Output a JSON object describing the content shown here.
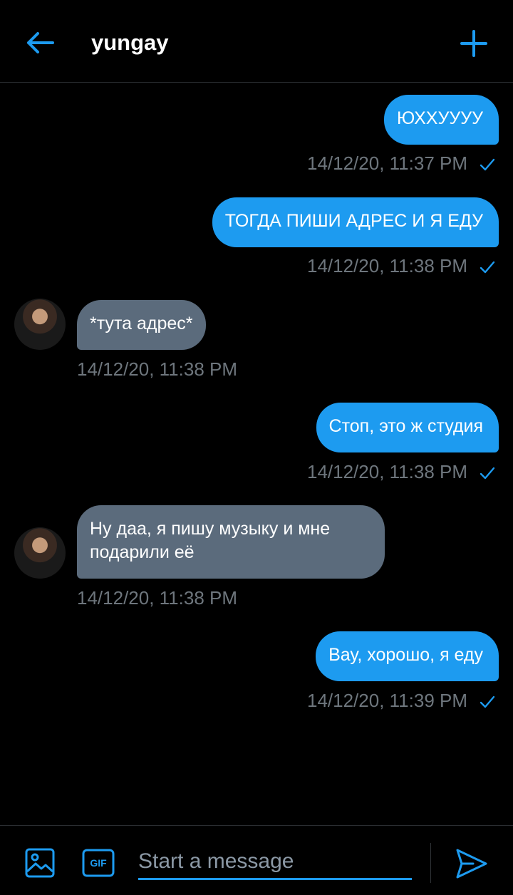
{
  "header": {
    "title": "yungay",
    "back_icon": "arrow-left-icon",
    "add_icon": "plus-icon",
    "accent": "#1d9bf0"
  },
  "messages": [
    {
      "direction": "out",
      "text": "ЮХХУУУУ",
      "timestamp": "14/12/20, 11:37 PM",
      "status": "sent-check-icon"
    },
    {
      "direction": "out",
      "text": "ТОГДА ПИШИ АДРЕС И Я ЕДУ",
      "timestamp": "14/12/20, 11:38 PM",
      "status": "sent-check-icon"
    },
    {
      "direction": "in",
      "text": "*тута адрес*",
      "timestamp": "14/12/20, 11:38 PM"
    },
    {
      "direction": "out",
      "text": "Стоп, это ж студия",
      "timestamp": "14/12/20, 11:38 PM",
      "status": "sent-check-icon"
    },
    {
      "direction": "in",
      "text": "Ну даа, я пишу музыку и мне\nподарили её",
      "timestamp": "14/12/20, 11:38 PM"
    },
    {
      "direction": "out",
      "text": "Вау, хорошо, я еду",
      "timestamp": "14/12/20, 11:39 PM",
      "status": "sent-check-icon"
    }
  ],
  "composer": {
    "placeholder": "Start a message",
    "image_icon": "image-icon",
    "gif_label": "GIF",
    "send_icon": "send-icon"
  },
  "colors": {
    "outgoing_bubble": "#1d9bf0",
    "incoming_bubble": "#5b6b7c",
    "timestamp": "#6e767d",
    "background": "#000000"
  }
}
